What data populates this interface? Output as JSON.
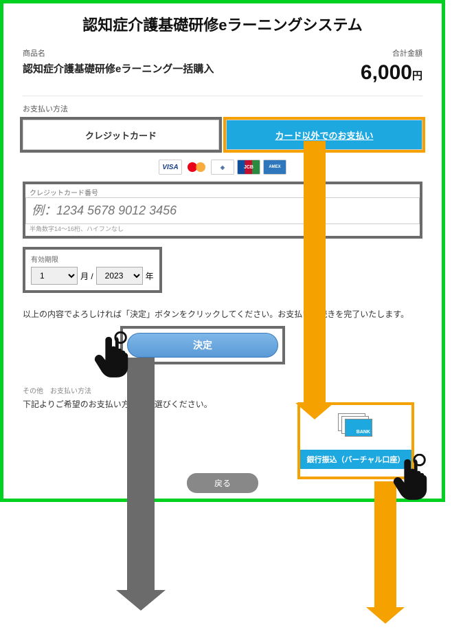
{
  "title": "認知症介護基礎研修eラーニングシステム",
  "product": {
    "label": "商品名",
    "name": "認知症介護基礎研修eラーニング一括購入"
  },
  "total": {
    "label": "合計金額",
    "amount": "6,000",
    "currency": "円"
  },
  "payment": {
    "label": "お支払い方法",
    "credit_label": "クレジットカード",
    "other_label": "カード以外でのお支払い"
  },
  "card_logos": {
    "visa": "VISA",
    "mastercard": "mastercard",
    "diners": "Diners Club",
    "jcb": "JCB",
    "amex": "AMERICAN EXPRESS"
  },
  "card_number": {
    "label": "クレジットカード番号",
    "placeholder": "例：1234 5678 9012 3456",
    "hint": "半角数字14～16桁、ハイフンなし"
  },
  "expiry": {
    "label": "有効期限",
    "month": "1",
    "month_unit": "月 /",
    "year": "2023",
    "year_unit": "年"
  },
  "confirm_text": "以上の内容でよろしければ「決定」ボタンをクリックしてください。お支払い手続きを完了いたします。",
  "submit_label": "決定",
  "other_section": {
    "label": "その他　お支払い方法",
    "text": "下記よりご希望のお支払い方法をお選びください。"
  },
  "bank": {
    "badge": "BANK",
    "label": "銀行振込（バーチャル口座）"
  },
  "back_label": "戻る"
}
